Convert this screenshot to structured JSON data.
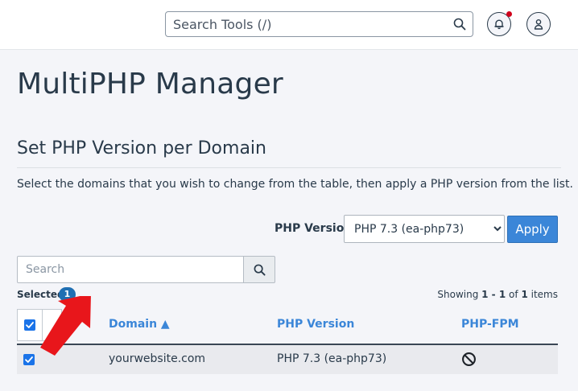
{
  "topbar": {
    "search_placeholder": "Search Tools (/)",
    "search_icon": "search-icon",
    "notifications_icon": "bell-icon",
    "user_icon": "user-icon",
    "notification_dot_color": "#d0021b"
  },
  "page": {
    "title": "MultiPHP Manager",
    "section_title": "Set PHP Version per Domain",
    "description": "Select the domains that you wish to change from the table, then apply a PHP version from the list."
  },
  "php_version": {
    "label": "PHP Version",
    "selected": "PHP 7.3 (ea-php73)",
    "apply_label": "Apply"
  },
  "table_tools": {
    "search_placeholder": "Search",
    "selected_label": "Selected",
    "selected_count": "1",
    "showing_prefix": "Showing",
    "showing_range": "1 - 1",
    "showing_of": "of",
    "showing_total": "1",
    "showing_suffix": "items"
  },
  "table": {
    "columns": [
      "Domain ▲",
      "PHP Version",
      "PHP-FPM"
    ],
    "rows": [
      {
        "checked": true,
        "domain": "yourwebsite.com",
        "php_version": "PHP 7.3 (ea-php73)",
        "php_fpm_icon": "disabled-icon"
      }
    ]
  },
  "colors": {
    "accent": "#3b86d8",
    "checkbox": "#1a73e8",
    "badge": "#1f6fb2",
    "arrow": "#e8161b"
  }
}
